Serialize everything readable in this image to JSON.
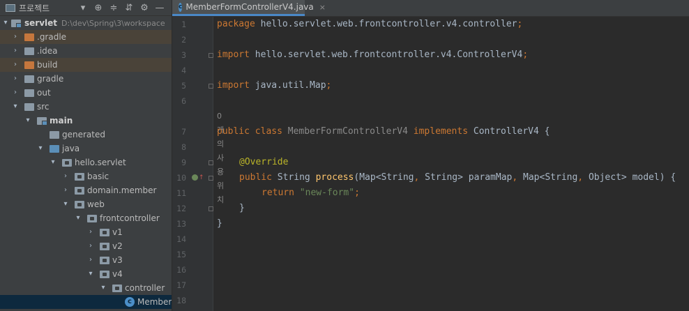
{
  "project_panel": {
    "title": "프로젝트",
    "root_name": "servlet",
    "root_path": "D:\\dev\\Spring\\3\\workspace"
  },
  "tree": [
    {
      "label": "servlet",
      "depth": 0
    },
    {
      "label": ".gradle",
      "depth": 1
    },
    {
      "label": ".idea",
      "depth": 1
    },
    {
      "label": "build",
      "depth": 1
    },
    {
      "label": "gradle",
      "depth": 1
    },
    {
      "label": "out",
      "depth": 1
    },
    {
      "label": "src",
      "depth": 1
    },
    {
      "label": "main",
      "depth": 2
    },
    {
      "label": "generated",
      "depth": 3
    },
    {
      "label": "java",
      "depth": 3
    },
    {
      "label": "hello.servlet",
      "depth": 4
    },
    {
      "label": "basic",
      "depth": 5
    },
    {
      "label": "domain.member",
      "depth": 5
    },
    {
      "label": "web",
      "depth": 5
    },
    {
      "label": "frontcontroller",
      "depth": 6
    },
    {
      "label": "v1",
      "depth": 7
    },
    {
      "label": "v2",
      "depth": 7
    },
    {
      "label": "v3",
      "depth": 7
    },
    {
      "label": "v4",
      "depth": 7
    },
    {
      "label": "controller",
      "depth": 8
    },
    {
      "label": "MemberF",
      "depth": 9
    }
  ],
  "editor": {
    "tab_label": "MemberFormControllerV4.java",
    "tab_close": "×",
    "usage_hint": "0개의 사용위치",
    "line_numbers": [
      "1",
      "2",
      "3",
      "4",
      "5",
      "6",
      "7",
      "8",
      "9",
      "10",
      "11",
      "12",
      "13",
      "14",
      "15",
      "16",
      "17",
      "18"
    ],
    "code": {
      "l1_kw": "package",
      "l1_rest": " hello.servlet.web.frontcontroller.v4.controller",
      "l1_semi": ";",
      "l3_kw": "import",
      "l3_rest": " hello.servlet.web.frontcontroller.v4.ControllerV4",
      "l3_semi": ";",
      "l5_kw": "import",
      "l5_rest": " java.util.Map",
      "l5_semi": ";",
      "l7_kw": "public class",
      "l7_name": " MemberFormControllerV4 ",
      "l7_kw2": "implements",
      "l7_rest": " ControllerV4 {",
      "l9_ann": "@Override",
      "l10_kw": "public",
      "l10_type": " String ",
      "l10_meth": "process",
      "l10_p1": "(Map<String",
      "l10_c1": ",",
      "l10_p2": " String> paramMap",
      "l10_c2": ",",
      "l10_p3": " Map<String",
      "l10_c3": ",",
      "l10_p4": " Object> model) {",
      "l11_kw": "return",
      "l11_str": " \"new-form\"",
      "l11_semi": ";",
      "l12": "}",
      "l13": "}"
    }
  },
  "colors": {
    "keyword": "#cc7832",
    "annotation": "#bbb529",
    "string": "#6a8759",
    "method": "#ffc66d",
    "selection": "#0d293e"
  }
}
